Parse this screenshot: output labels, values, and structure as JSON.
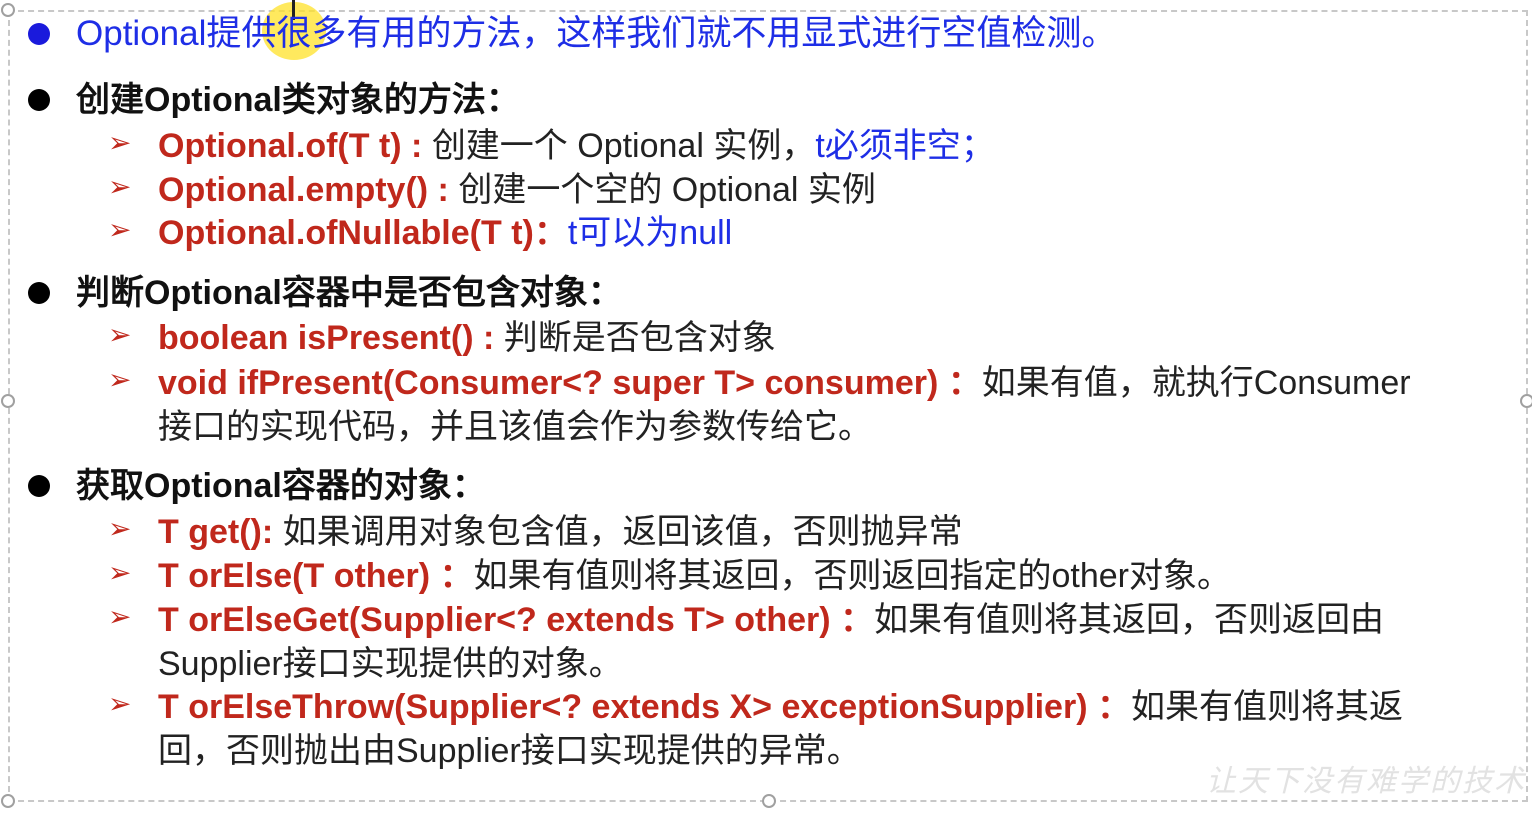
{
  "top": {
    "text": "Optional提供很多有用的方法，这样我们就不用显式进行空值检测。"
  },
  "sections": [
    {
      "title": "创建Optional类对象的方法：",
      "items": [
        {
          "sig": "Optional.of(T t) : ",
          "desc": "创建一个 Optional 实例，",
          "extra": "t必须非空；"
        },
        {
          "sig": "Optional.empty() : ",
          "desc": "创建一个空的 Optional 实例"
        },
        {
          "sig": "Optional.ofNullable(T t)：",
          "extra": "t可以为null"
        }
      ]
    },
    {
      "title": "判断Optional容器中是否包含对象：",
      "items": [
        {
          "sig": "boolean isPresent() : ",
          "desc": "判断是否包含对象"
        },
        {
          "sig": "void ifPresent(Consumer<? super T> consumer) ：",
          "desc": "如果有值，就执行Consumer",
          "cont": "接口的实现代码，并且该值会作为参数传给它。"
        }
      ]
    },
    {
      "title": "获取Optional容器的对象：",
      "items": [
        {
          "sig": "T get(): ",
          "desc": "如果调用对象包含值，返回该值，否则抛异常"
        },
        {
          "sig": "T orElse(T other) ：",
          "desc": "如果有值则将其返回，否则返回指定的other对象。"
        },
        {
          "sig": "T orElseGet(Supplier<? extends T> other) ：",
          "desc": "如果有值则将其返回，否则返回由",
          "cont": "Supplier接口实现提供的对象。"
        },
        {
          "sig": "T orElseThrow(Supplier<? extends X> exceptionSupplier) ：",
          "desc": "如果有值则将其返",
          "cont": "回，否则抛出由Supplier接口实现提供的异常。"
        }
      ]
    }
  ],
  "watermark": "让天下没有难学的技术",
  "colors": {
    "signature": "#c0281c",
    "top_text": "#1e2ee6",
    "bullet_top": "#1a1adc",
    "highlight": "#ffe128"
  }
}
